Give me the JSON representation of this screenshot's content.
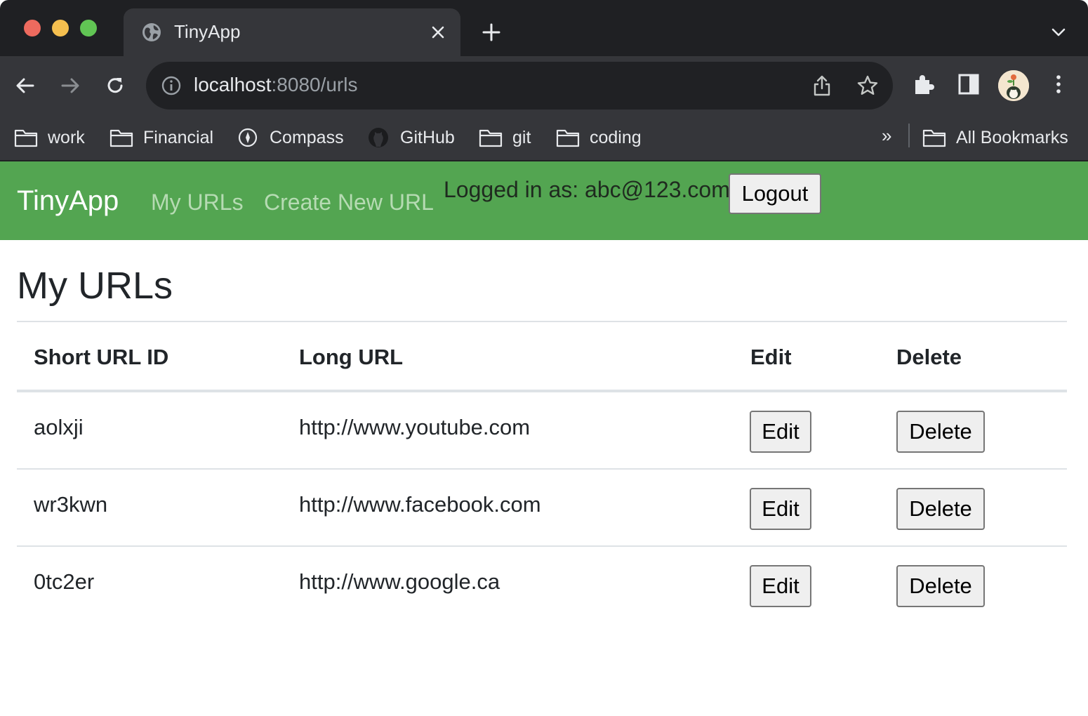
{
  "browser": {
    "tab_title": "TinyApp",
    "url_host": "localhost",
    "url_rest": ":8080/urls",
    "bookmarks": [
      {
        "label": "work",
        "icon": "folder-icon"
      },
      {
        "label": "Financial",
        "icon": "folder-icon"
      },
      {
        "label": "Compass",
        "icon": "compass-icon"
      },
      {
        "label": "GitHub",
        "icon": "github-icon"
      },
      {
        "label": "git",
        "icon": "folder-icon"
      },
      {
        "label": "coding",
        "icon": "folder-icon"
      }
    ],
    "overflow_label": "»",
    "all_bookmarks_label": "All Bookmarks"
  },
  "navbar": {
    "brand": "TinyApp",
    "links": [
      "My URLs",
      "Create New URL"
    ],
    "logged_in_text": "Logged in as: abc@123.com",
    "logout_label": "Logout",
    "background_color": "#53a551"
  },
  "main": {
    "title": "My URLs",
    "table": {
      "headers": [
        "Short URL ID",
        "Long URL",
        "Edit",
        "Delete"
      ],
      "rows": [
        {
          "id": "aolxji",
          "long_url": "http://www.youtube.com",
          "edit_label": "Edit",
          "delete_label": "Delete"
        },
        {
          "id": "wr3kwn",
          "long_url": "http://www.facebook.com",
          "edit_label": "Edit",
          "delete_label": "Delete"
        },
        {
          "id": "0tc2er",
          "long_url": "http://www.google.ca",
          "edit_label": "Edit",
          "delete_label": "Delete"
        }
      ]
    }
  }
}
